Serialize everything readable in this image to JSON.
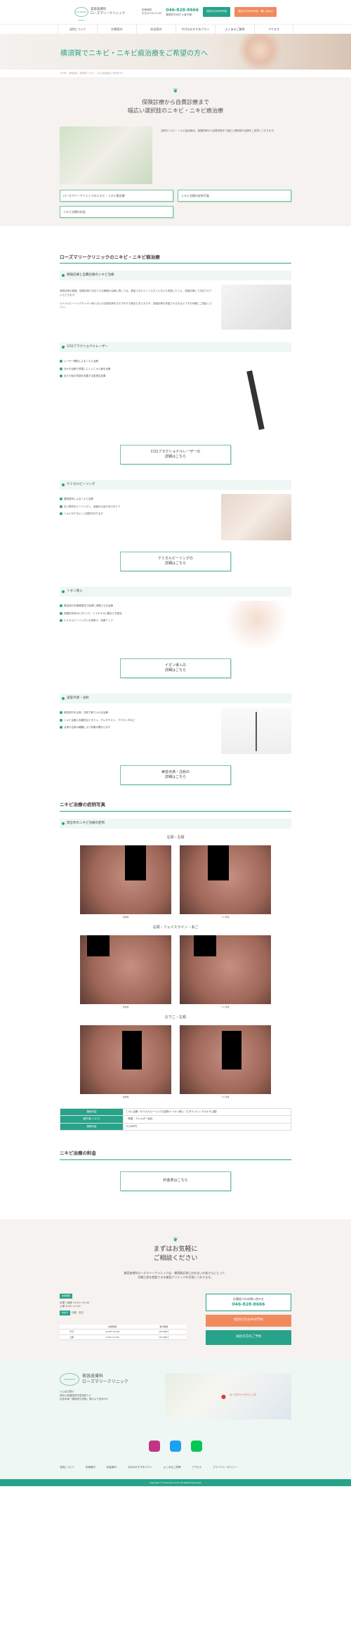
{
  "header": {
    "logo_mark": "ROSEMARY CLINIC",
    "logo_line1": "美容皮膚科",
    "logo_line2": "ローズマリークリニック",
    "hours_line1": "診療時間",
    "hours_line2": "平日10:00-19:00",
    "tel": "046-828-8666",
    "address": "横須賀市本町 大滝 町駅",
    "btn_web": "初診の方WEB予約",
    "btn_web2": "再診の方WEB予約・問い合わせ"
  },
  "nav": [
    "当院について",
    "診療案内",
    "料金案内",
    "今月のおすすめプラン",
    "よくあるご質問",
    "アクセス"
  ],
  "hero": {
    "title": "横須賀でニキビ・ニキビ痕治療をご希望の方へ"
  },
  "breadcrumb": [
    "HOME",
    "診療案内",
    "横須賀でニキビ・ニキビ痕治療をご希望の方へ"
  ],
  "intro": {
    "title_line1": "保険診療から自費診療まで",
    "title_line2": "幅広い選択肢のニキビ・ニキビ痕治療",
    "text": "当院のニキビ・ニキビ痕治療は、保険診療から自費診療まで幅広い選択肢の治療をご用意しております。",
    "toc": [
      "ローズマリークリニックのニキビ・ニキビ痕治療",
      "ニキビ治療の症例写真",
      "ニキビ治療の料金"
    ]
  },
  "section1": {
    "title": "ローズマリークリニックのニキビ・ニキビ痕治療",
    "blocks": [
      {
        "heading": "保険診療と自費診療のニキビ治療",
        "text1": "保険診療の範囲、保険診療で対応できる範囲の治療に際しては、患者さまのライフスタイルなども考慮したうえ、保険診療にて対応させていただきます。",
        "text2": "ケミカルピーリングやイオン導入などの自費診療をおすすめする場合もありますが、保険診療を希望される方はどうぞお気軽にご相談ください。"
      },
      {
        "heading": "CO2フラクショナルレーザー",
        "items": [
          "レーザー照射によるニキビ治療",
          "ほかの治療で改善しにくいニキビ痕を治療",
          "毛穴や肌の質感を改善する肌再生効果"
        ],
        "button": [
          "CO2フラクショナルレーザーの",
          "詳細はこちら"
        ]
      },
      {
        "heading": "ケミカルピーリング",
        "items": [
          "薬剤塗布によるニキビ治療",
          "古い角質をピーリングし、皮脂の分泌や毛穴をケア",
          "ニキビができにくい肌質を作ります"
        ],
        "button": [
          "ケミカルピーリングの",
          "詳細はこちら"
        ]
      },
      {
        "heading": "イオン導入",
        "items": [
          "美容成分を微弱電流で皮膚に浸透させる治療",
          "抗酸化作用のビタミンC、トラネキサム酸などを配合",
          "ケミカルピーリングとの併用で、効果アップ"
        ],
        "button": [
          "イオン導入の",
          "詳細はこちら"
        ]
      },
      {
        "heading": "美容点滴・注射",
        "items": [
          "美容成分を点滴、注射で取り入れる治療",
          "ニキビ治療に効果的なビタミン、グルタチオン、プラセンタなど",
          "点滴や注射の種類により効果が異なります"
        ],
        "button": [
          "美容点滴・注射の",
          "詳細はこちら"
        ]
      }
    ]
  },
  "cases": {
    "title": "ニキビ治療の症例写真",
    "subheading": "顔全体のニキビ治療の症例",
    "groups": [
      {
        "label": "左頬・左頬",
        "before": "治療前",
        "after": "3ヶ月後"
      },
      {
        "label": "右頬・フェイスライン・あご",
        "before": "治療前",
        "after": "3ヶ月後"
      },
      {
        "label": "おでこ・左頬",
        "before": "治療前",
        "after": "3ヶ月後"
      }
    ],
    "table": [
      {
        "th": "施術内容",
        "td": "ニキビ治療（ケミカルピーリング(自費)＋イオン導入（ビタミンC,トラネキサム酸）"
      },
      {
        "th": "副作用(リスク)",
        "td": "・刺激・アレルギー反応"
      },
      {
        "th": "施術料金",
        "td": "11,000円"
      }
    ]
  },
  "price": {
    "title": "ニキビ治療の料金",
    "button": "料金表はこちら"
  },
  "contact": {
    "title_line1": "まずはお気軽に",
    "title_line2": "ご相談ください",
    "text1": "美容皮膚科ローズマリークリニックは、横須賀近郊にお住まいの皆さんにとって、",
    "text2": "気軽に肌を相談できる美容クリニックを目指しております。",
    "hours_tag": "診療時間",
    "hours": "月曜～金曜 10:00～19:00\n土曜 9:00～17:00",
    "closed_tag": "休診日",
    "closed": "日曜、祝日",
    "tel_label": "お電話でのお問い合わせ",
    "tel": "046-828-8666",
    "web_btn": "初診の方はWEB予約",
    "web_btn2": "再診の方のご予約",
    "hours_table_header": [
      "",
      "診療時間",
      "受付時間"
    ],
    "hours_table": [
      [
        "平日",
        "10:00～19:00",
        "18:30まで"
      ],
      [
        "土曜",
        "9:00～17:00",
        "16:30まで"
      ]
    ]
  },
  "footer": {
    "clinic_line1": "美容皮膚科",
    "clinic_line2": "ローズマリークリニック",
    "address": "〒238-0007\n神奈川県横須賀市若松町2-4\n京急本線「横須賀中央駅」東口より徒歩3分",
    "map_label": "ローズマリークリニック",
    "nav": [
      "当院について",
      "診療案内",
      "料金案内",
      "今月のおすすめプラン",
      "よくあるご質問",
      "アクセス",
      "プライバシーポリシー"
    ],
    "copyright": "Copyright © Rosemary Clinic All Rights Reserved."
  },
  "colors": {
    "accent": "#27a38a",
    "orange": "#f08a5d",
    "beige": "#f5f2ef"
  }
}
